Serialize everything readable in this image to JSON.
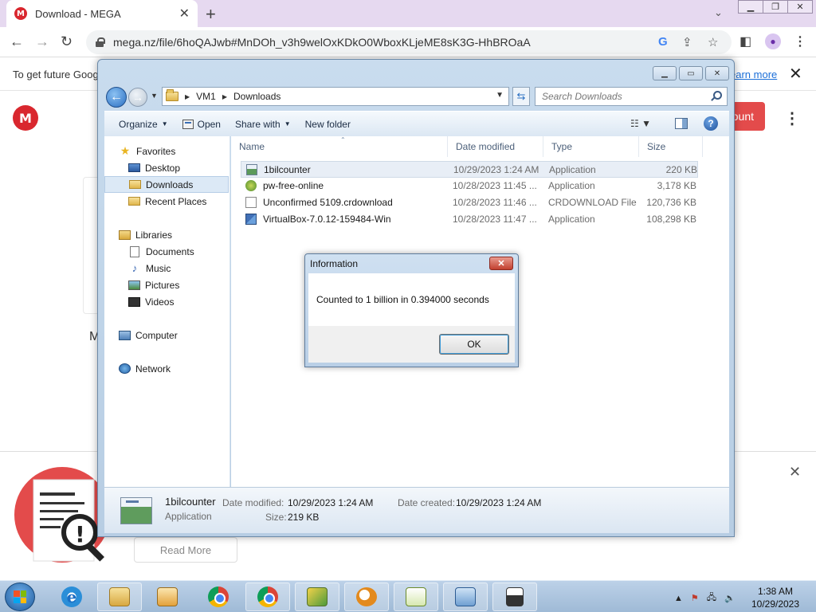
{
  "browser": {
    "tab_title": "Download - MEGA",
    "favicon_letter": "M",
    "url": "mega.nz/file/6hoQAJwb#MnDOh_v3h9welOxKDkO0WboxKLjeME8sK3G-HhBROaA"
  },
  "mega": {
    "banner_text": "To get future Goog",
    "banner_link": "earn more",
    "logo_letter": "M",
    "cta_label": "ount",
    "partial_letter": "M",
    "read_more": "Read More"
  },
  "explorer": {
    "breadcrumbs": [
      "VM1",
      "Downloads"
    ],
    "search_placeholder": "Search Downloads",
    "commands": {
      "organize": "Organize",
      "open": "Open",
      "share_with": "Share with",
      "new_folder": "New folder"
    },
    "nav": {
      "favorites": "Favorites",
      "desktop": "Desktop",
      "downloads": "Downloads",
      "recent_places": "Recent Places",
      "libraries": "Libraries",
      "documents": "Documents",
      "music": "Music",
      "pictures": "Pictures",
      "videos": "Videos",
      "computer": "Computer",
      "network": "Network"
    },
    "columns": {
      "name": "Name",
      "date_modified": "Date modified",
      "type": "Type",
      "size": "Size"
    },
    "files": [
      {
        "name": "1bilcounter",
        "date": "10/29/2023 1:24 AM",
        "type": "Application",
        "size": "220 KB",
        "icon": "application-icon"
      },
      {
        "name": "pw-free-online",
        "date": "10/28/2023 11:45 ...",
        "type": "Application",
        "size": "3,178 KB",
        "icon": "setup-icon"
      },
      {
        "name": "Unconfirmed 5109.crdownload",
        "date": "10/28/2023 11:46 ...",
        "type": "CRDOWNLOAD File",
        "size": "120,736 KB",
        "icon": "blank-file-icon"
      },
      {
        "name": "VirtualBox-7.0.12-159484-Win",
        "date": "10/28/2023 11:47 ...",
        "type": "Application",
        "size": "108,298 KB",
        "icon": "virtualbox-icon"
      }
    ],
    "details": {
      "name": "1bilcounter",
      "type": "Application",
      "date_modified_label": "Date modified:",
      "date_modified": "10/29/2023 1:24 AM",
      "date_created_label": "Date created:",
      "date_created": "10/29/2023 1:24 AM",
      "size_label": "Size:",
      "size": "219 KB"
    }
  },
  "dialog": {
    "title": "Information",
    "message": "Counted to 1 billion in 0.394000 seconds",
    "ok_label": "OK"
  },
  "taskbar": {
    "time": "1:38 AM",
    "date": "10/29/2023"
  },
  "colors": {
    "mega_red": "#d9272e",
    "taskbar": "#bcd1e8",
    "selection": "#dce9f6"
  }
}
